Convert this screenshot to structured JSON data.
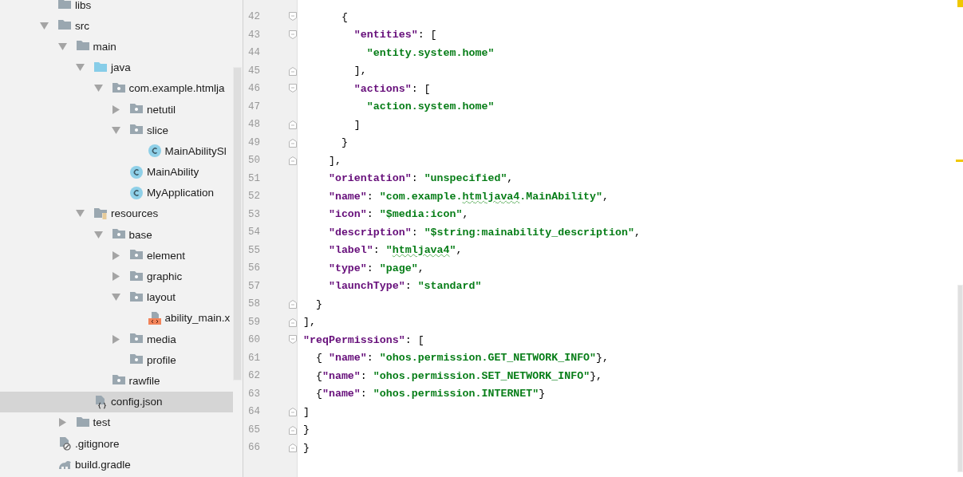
{
  "project_tree": [
    {
      "label": "libs",
      "kind": "folder"
    },
    {
      "label": "src",
      "kind": "folder",
      "expanded": true,
      "children": [
        {
          "label": "main",
          "kind": "folder",
          "expanded": true,
          "children": [
            {
              "label": "java",
              "kind": "sources",
              "expanded": true,
              "children": [
                {
                  "label": "com.example.htmlja",
                  "kind": "package",
                  "expanded": true,
                  "children": [
                    {
                      "label": "netutil",
                      "kind": "package",
                      "expanded": false
                    },
                    {
                      "label": "slice",
                      "kind": "package",
                      "expanded": true,
                      "children": [
                        {
                          "label": "MainAbilitySl",
                          "kind": "class"
                        }
                      ]
                    },
                    {
                      "label": "MainAbility",
                      "kind": "class"
                    },
                    {
                      "label": "MyApplication",
                      "kind": "class"
                    }
                  ]
                }
              ]
            },
            {
              "label": "resources",
              "kind": "resources",
              "expanded": true,
              "children": [
                {
                  "label": "base",
                  "kind": "package",
                  "expanded": true,
                  "children": [
                    {
                      "label": "element",
                      "kind": "package",
                      "expanded": false
                    },
                    {
                      "label": "graphic",
                      "kind": "package",
                      "expanded": false
                    },
                    {
                      "label": "layout",
                      "kind": "package",
                      "expanded": true,
                      "children": [
                        {
                          "label": "ability_main.x",
                          "kind": "xml"
                        }
                      ]
                    },
                    {
                      "label": "media",
                      "kind": "package",
                      "expanded": false
                    },
                    {
                      "label": "profile",
                      "kind": "package"
                    }
                  ]
                },
                {
                  "label": "rawfile",
                  "kind": "package"
                }
              ]
            },
            {
              "label": "config.json",
              "kind": "json",
              "selected": true
            }
          ]
        },
        {
          "label": "test",
          "kind": "folder",
          "expanded": false
        }
      ]
    },
    {
      "label": ".gitignore",
      "kind": "ignore"
    },
    {
      "label": "build.gradle",
      "kind": "gradle"
    }
  ],
  "editor": {
    "lines": [
      {
        "number": "42",
        "kind": "opener",
        "tokens": [
          {
            "kind": "plain",
            "text": "      {"
          }
        ]
      },
      {
        "number": "43",
        "kind": "opener",
        "tokens": [
          {
            "kind": "key",
            "text": "        \"entities\""
          },
          {
            "kind": "plain",
            "text": ": ["
          }
        ]
      },
      {
        "number": "44",
        "tokens": [
          {
            "kind": "string",
            "text": "          \"entity.system.home\""
          }
        ]
      },
      {
        "number": "45",
        "kind": "closer",
        "tokens": [
          {
            "kind": "plain",
            "text": "        ],"
          }
        ]
      },
      {
        "number": "46",
        "kind": "opener",
        "tokens": [
          {
            "kind": "key",
            "text": "        \"actions\""
          },
          {
            "kind": "plain",
            "text": ": ["
          }
        ]
      },
      {
        "number": "47",
        "tokens": [
          {
            "kind": "string",
            "text": "          \"action.system.home\""
          }
        ]
      },
      {
        "number": "48",
        "kind": "closer",
        "tokens": [
          {
            "kind": "plain",
            "text": "        ]"
          }
        ]
      },
      {
        "number": "49",
        "kind": "closer",
        "tokens": [
          {
            "kind": "plain",
            "text": "      }"
          }
        ]
      },
      {
        "number": "50",
        "kind": "closer",
        "tokens": [
          {
            "kind": "plain",
            "text": "    ],"
          }
        ]
      },
      {
        "number": "51",
        "tokens": [
          {
            "kind": "key",
            "text": "    \"orientation\""
          },
          {
            "kind": "plain",
            "text": ": "
          },
          {
            "kind": "string",
            "text": "\"unspecified\""
          },
          {
            "kind": "plain",
            "text": ","
          }
        ]
      },
      {
        "number": "52",
        "tokens": [
          {
            "kind": "key",
            "text": "    \"name\""
          },
          {
            "kind": "plain",
            "text": ": "
          },
          {
            "kind": "string",
            "text": "\"com.example."
          },
          {
            "kind": "string",
            "text": "htmljava4",
            "underlined": true
          },
          {
            "kind": "string",
            "text": ".MainAbility\""
          },
          {
            "kind": "plain",
            "text": ","
          }
        ]
      },
      {
        "number": "53",
        "tokens": [
          {
            "kind": "key",
            "text": "    \"icon\""
          },
          {
            "kind": "plain",
            "text": ": "
          },
          {
            "kind": "string",
            "text": "\"$media:icon\""
          },
          {
            "kind": "plain",
            "text": ","
          }
        ]
      },
      {
        "number": "54",
        "tokens": [
          {
            "kind": "key",
            "text": "    \"description\""
          },
          {
            "kind": "plain",
            "text": ": "
          },
          {
            "kind": "string",
            "text": "\"$string:mainability_description\""
          },
          {
            "kind": "plain",
            "text": ","
          }
        ]
      },
      {
        "number": "55",
        "tokens": [
          {
            "kind": "key",
            "text": "    \"label\""
          },
          {
            "kind": "plain",
            "text": ": "
          },
          {
            "kind": "string",
            "text": "\""
          },
          {
            "kind": "string",
            "text": "htmljava4",
            "underlined": true
          },
          {
            "kind": "string",
            "text": "\""
          },
          {
            "kind": "plain",
            "text": ","
          }
        ]
      },
      {
        "number": "56",
        "tokens": [
          {
            "kind": "key",
            "text": "    \"type\""
          },
          {
            "kind": "plain",
            "text": ": "
          },
          {
            "kind": "string",
            "text": "\"page\""
          },
          {
            "kind": "plain",
            "text": ","
          }
        ]
      },
      {
        "number": "57",
        "tokens": [
          {
            "kind": "key",
            "text": "    \"launchType\""
          },
          {
            "kind": "plain",
            "text": ": "
          },
          {
            "kind": "string",
            "text": "\"standard\""
          }
        ]
      },
      {
        "number": "58",
        "kind": "closer",
        "tokens": [
          {
            "kind": "plain",
            "text": "  }"
          }
        ]
      },
      {
        "number": "59",
        "kind": "closer",
        "tokens": [
          {
            "kind": "plain",
            "text": "],"
          }
        ]
      },
      {
        "number": "60",
        "kind": "opener",
        "tokens": [
          {
            "kind": "key",
            "text": "\"reqPermissions\""
          },
          {
            "kind": "plain",
            "text": ": ["
          }
        ]
      },
      {
        "number": "61",
        "tokens": [
          {
            "kind": "plain",
            "text": "  { "
          },
          {
            "kind": "key",
            "text": "\"name\""
          },
          {
            "kind": "plain",
            "text": ": "
          },
          {
            "kind": "string",
            "text": "\"ohos.permission.GET_NETWORK_INFO\""
          },
          {
            "kind": "plain",
            "text": "},"
          }
        ]
      },
      {
        "number": "62",
        "tokens": [
          {
            "kind": "plain",
            "text": "  {"
          },
          {
            "kind": "key",
            "text": "\"name\""
          },
          {
            "kind": "plain",
            "text": ": "
          },
          {
            "kind": "string",
            "text": "\"ohos.permission.SET_NETWORK_INFO\""
          },
          {
            "kind": "plain",
            "text": "},"
          }
        ]
      },
      {
        "number": "63",
        "tokens": [
          {
            "kind": "plain",
            "text": "  {"
          },
          {
            "kind": "key",
            "text": "\"name\""
          },
          {
            "kind": "plain",
            "text": ": "
          },
          {
            "kind": "string",
            "text": "\"ohos.permission.INTERNET\""
          },
          {
            "kind": "plain",
            "text": "}"
          }
        ]
      },
      {
        "number": "64",
        "kind": "closer",
        "tokens": [
          {
            "kind": "plain",
            "text": "]"
          }
        ]
      },
      {
        "number": "65",
        "kind": "closer",
        "tokens": [
          {
            "kind": "plain",
            "text": "}"
          }
        ]
      },
      {
        "number": "66",
        "kind": "closer",
        "tokens": [
          {
            "kind": "plain",
            "text": "}"
          }
        ]
      }
    ]
  }
}
